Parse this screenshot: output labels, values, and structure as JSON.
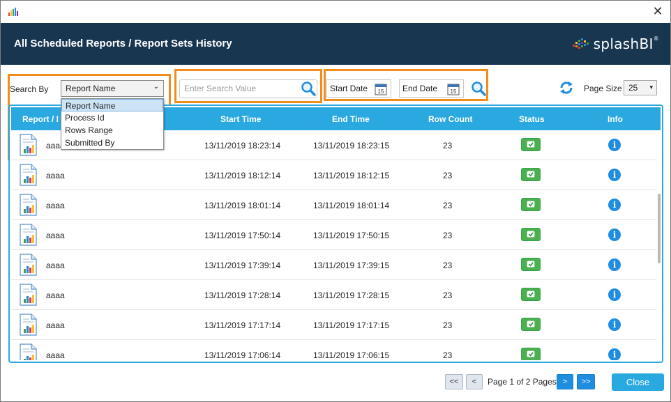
{
  "window": {
    "close_glyph": "✕"
  },
  "header": {
    "title": "All Scheduled Reports / Report Sets History",
    "logo_text": "splashBI",
    "logo_mark": "®"
  },
  "filters": {
    "search_by_label": "Search By",
    "search_by_value": "Report Name",
    "search_by_options": [
      "Report Name",
      "Process Id",
      "Rows Range",
      "Submitted By"
    ],
    "search_placeholder": "Enter Search Value",
    "start_date_label": "Start Date",
    "end_date_label": "End Date",
    "calendar_day": "15",
    "page_size_label": "Page Size",
    "page_size_value": "25"
  },
  "grid": {
    "columns": {
      "report": "Report / I",
      "start_time": "Start Time",
      "end_time": "End Time",
      "row_count": "Row Count",
      "status": "Status",
      "info": "Info"
    },
    "rows": [
      {
        "name": "aaaa",
        "start": "13/11/2019 18:23:14",
        "end": "13/11/2019 18:23:15",
        "count": "23"
      },
      {
        "name": "aaaa",
        "start": "13/11/2019 18:12:14",
        "end": "13/11/2019 18:12:15",
        "count": "23"
      },
      {
        "name": "aaaa",
        "start": "13/11/2019 18:01:14",
        "end": "13/11/2019 18:01:14",
        "count": "23"
      },
      {
        "name": "aaaa",
        "start": "13/11/2019 17:50:14",
        "end": "13/11/2019 17:50:15",
        "count": "23"
      },
      {
        "name": "aaaa",
        "start": "13/11/2019 17:39:14",
        "end": "13/11/2019 17:39:15",
        "count": "23"
      },
      {
        "name": "aaaa",
        "start": "13/11/2019 17:28:14",
        "end": "13/11/2019 17:28:15",
        "count": "23"
      },
      {
        "name": "aaaa",
        "start": "13/11/2019 17:17:14",
        "end": "13/11/2019 17:17:15",
        "count": "23"
      },
      {
        "name": "aaaa",
        "start": "13/11/2019 17:06:14",
        "end": "13/11/2019 17:06:15",
        "count": "23"
      }
    ]
  },
  "pager": {
    "first": "<<",
    "prev": "<",
    "info": "Page 1 of 2 Pages",
    "next": ">",
    "last": ">>",
    "close": "Close"
  },
  "colors": {
    "header_bg": "#183650",
    "accent": "#2aa8e0",
    "highlight": "#f28c1c",
    "status_ok": "#4caf50",
    "info": "#1f8de0"
  }
}
